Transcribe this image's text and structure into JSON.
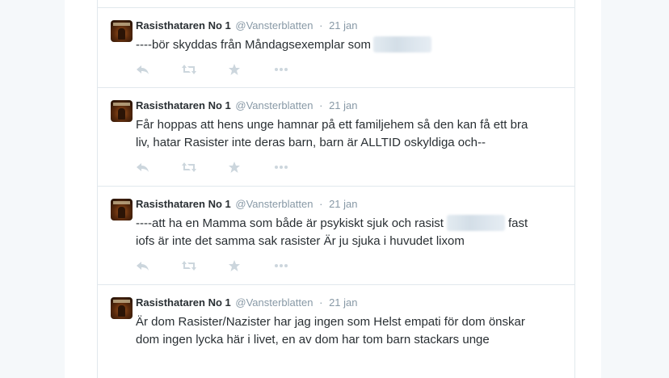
{
  "colors": {
    "name": "#292f33",
    "meta": "#8899a6",
    "icon": "#ccd6dd",
    "border": "#e1e8ed"
  },
  "icons": [
    "reply-icon",
    "retweet-icon",
    "favorite-star-icon",
    "more-dots-icon"
  ],
  "tweets": [
    {
      "name": "Rasisthataren No 1",
      "handle": "@Vansterblatten",
      "separator": "·",
      "time": "21 jan",
      "lines": [
        "----bör skyddas från Måndagsexemplar som"
      ]
    },
    {
      "name": "Rasisthataren No 1",
      "handle": "@Vansterblatten",
      "separator": "·",
      "time": "21 jan",
      "lines": [
        "Får hoppas att hens unge hamnar på ett familjehem så den kan få ett bra",
        "liv, hatar Rasister inte deras barn, barn är ALLTID oskyldiga och--"
      ]
    },
    {
      "name": "Rasisthataren No 1",
      "handle": "@Vansterblatten",
      "separator": "·",
      "time": "21 jan",
      "lines": [
        "----att ha en Mamma som både är psykiskt sjuk och rasist",
        "fast",
        "iofs är inte det samma sak rasister Är ju sjuka i huvudet lixom"
      ]
    },
    {
      "name": "Rasisthataren No 1",
      "handle": "@Vansterblatten",
      "separator": "·",
      "time": "21 jan",
      "lines": [
        "Är dom Rasister/Nazister har jag ingen som Helst empati för dom önskar",
        "dom ingen lycka här i livet, en av dom har tom barn stackars unge"
      ]
    }
  ]
}
